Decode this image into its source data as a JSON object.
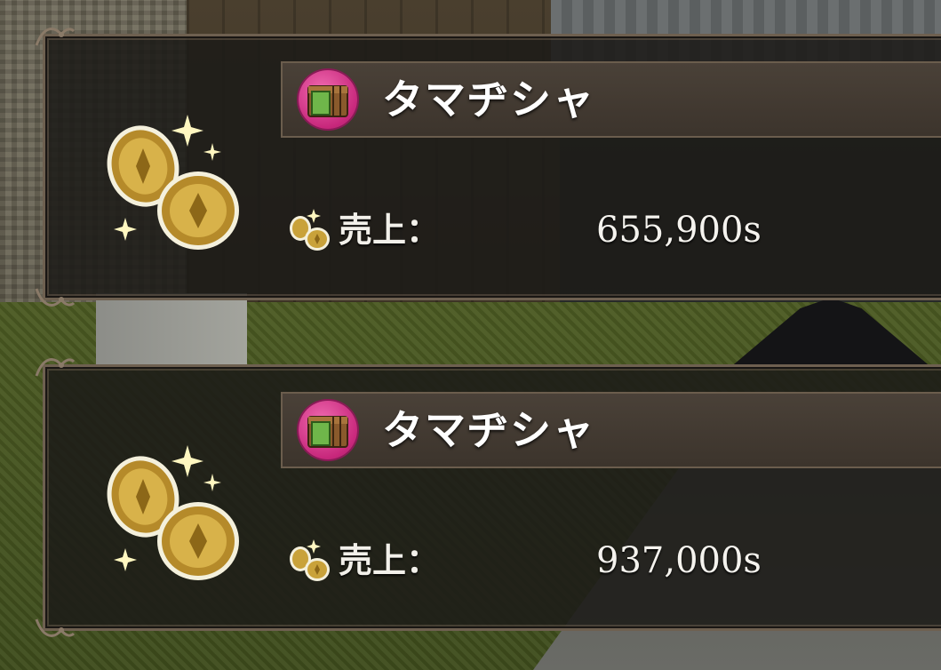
{
  "notifications": [
    {
      "shop_name": "タマヂシャ",
      "sales_label": "売上：",
      "sales_amount": "655,900s",
      "shop_icon": "treasure-chest-icon",
      "currency_icon": "gold-coins-icon"
    },
    {
      "shop_name": "タマヂシャ",
      "sales_label": "売上：",
      "sales_amount": "937,000s",
      "shop_icon": "treasure-chest-icon",
      "currency_icon": "gold-coins-icon"
    }
  ],
  "colors": {
    "panel_bg": "#1c1b18",
    "panel_border": "#6e6050",
    "badge_pink": "#d13485",
    "coin_gold": "#c9a23a",
    "text": "#ffffff"
  }
}
